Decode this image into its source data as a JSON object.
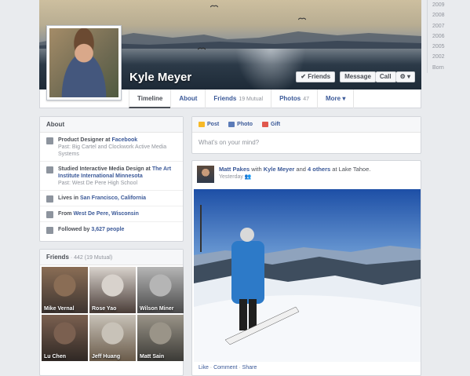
{
  "profile": {
    "name": "Kyle Meyer",
    "friends_button": "✔ Friends",
    "message_button": "Message",
    "call_button": "Call",
    "gear_button": "⚙ ▾"
  },
  "nav": {
    "tabs": [
      {
        "label": "Timeline",
        "count": ""
      },
      {
        "label": "About",
        "count": ""
      },
      {
        "label": "Friends",
        "count": "19 Mutual"
      },
      {
        "label": "Photos",
        "count": "47"
      },
      {
        "label": "More ▾",
        "count": ""
      }
    ]
  },
  "timeline_years": [
    "2009",
    "2008",
    "2007",
    "2006",
    "2005",
    "2002",
    "Born"
  ],
  "about": {
    "title": "About",
    "items": [
      {
        "icon": "briefcase-icon",
        "line": "Product Designer at ",
        "link": "Facebook",
        "line2": "",
        "past": "Past: Big Cartel and Clockwork Active Media Systems"
      },
      {
        "icon": "graduation-cap-icon",
        "line": "Studied Interactive Media Design at ",
        "link": "The Art Institute International Minnesota",
        "line2": "",
        "past": "Past: West De Pere High School"
      },
      {
        "icon": "home-icon",
        "line": "Lives in ",
        "link": "San Francisco, California",
        "line2": "",
        "past": ""
      },
      {
        "icon": "location-pin-icon",
        "line": "From ",
        "link": "West De Pere, Wisconsin",
        "line2": "",
        "past": ""
      },
      {
        "icon": "rss-icon",
        "line": "Followed by ",
        "link": "3,627 people",
        "line2": "",
        "past": ""
      }
    ]
  },
  "friends_panel": {
    "title": "Friends",
    "sub": " · 442 (19 Mutual)",
    "friends": [
      {
        "name": "Mike Vernal",
        "c1": "#8a6d55",
        "c2": "#3d3430"
      },
      {
        "name": "Rose Yao",
        "c1": "#d8d2cc",
        "c2": "#4a3d38"
      },
      {
        "name": "Wilson Miner",
        "c1": "#b5b5b5",
        "c2": "#4a4a4a"
      },
      {
        "name": "Lu Chen",
        "c1": "#7b6050",
        "c2": "#2f2824"
      },
      {
        "name": "Jeff Huang",
        "c1": "#c8c2b8",
        "c2": "#6a5b4a"
      },
      {
        "name": "Matt Sain",
        "c1": "#9a9488",
        "c2": "#3b3a36"
      }
    ]
  },
  "composer": {
    "tabs": [
      "Post",
      "Photo",
      "Gift"
    ],
    "placeholder": "What's on your mind?"
  },
  "story": {
    "author": "Matt Pakes",
    "with_text": " with ",
    "tagged": "Kyle Meyer",
    "and_text": " and ",
    "others": "4 others",
    "at_text": " at Lake Tahoe.",
    "time": "Yesterday",
    "like": "Like",
    "comment": "Comment",
    "share": "Share",
    "sep": " · "
  },
  "colors": {
    "link": "#3b5998",
    "page_bg": "#e9ebee"
  }
}
